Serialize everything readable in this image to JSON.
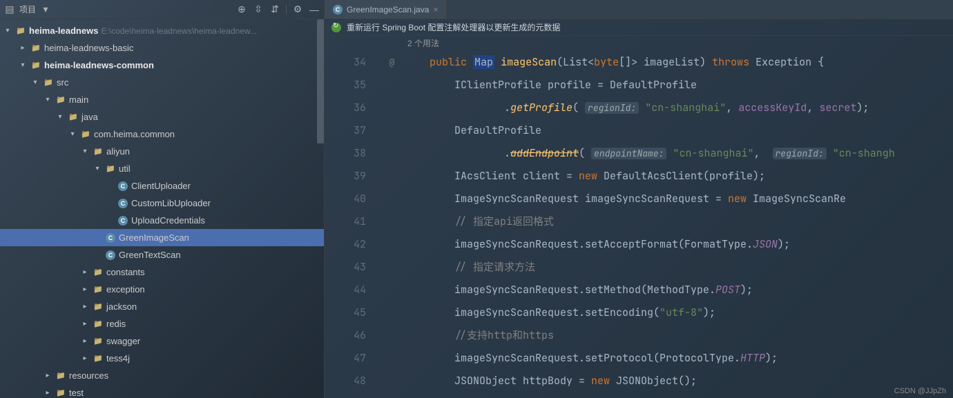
{
  "toolbar": {
    "label": "项目",
    "dropdown_icon": "chevron-down"
  },
  "tree": {
    "root": {
      "name": "heima-leadnews",
      "path": "E:\\code\\heima-leadnews\\heima-leadnew..."
    },
    "items": [
      {
        "level": 1,
        "name": "heima-leadnews-basic",
        "arrow": ">"
      },
      {
        "level": 1,
        "name": "heima-leadnews-common",
        "arrow": "v",
        "bold": true
      },
      {
        "level": 2,
        "name": "src",
        "arrow": "v"
      },
      {
        "level": 3,
        "name": "main",
        "arrow": "v"
      },
      {
        "level": 4,
        "name": "java",
        "arrow": "v"
      },
      {
        "level": 5,
        "name": "com.heima.common",
        "arrow": "v"
      },
      {
        "level": 6,
        "name": "aliyun",
        "arrow": "v"
      },
      {
        "level": 7,
        "name": "util",
        "arrow": "v"
      },
      {
        "level": 8,
        "name": "ClientUploader",
        "class": true
      },
      {
        "level": 8,
        "name": "CustomLibUploader",
        "class": true
      },
      {
        "level": 8,
        "name": "UploadCredentials",
        "class": true
      },
      {
        "level": 7,
        "name": "GreenImageScan",
        "class": true,
        "selected": true
      },
      {
        "level": 7,
        "name": "GreenTextScan",
        "class": true
      },
      {
        "level": 6,
        "name": "constants",
        "arrow": ">"
      },
      {
        "level": 6,
        "name": "exception",
        "arrow": ">"
      },
      {
        "level": 6,
        "name": "jackson",
        "arrow": ">"
      },
      {
        "level": 6,
        "name": "redis",
        "arrow": ">"
      },
      {
        "level": 6,
        "name": "swagger",
        "arrow": ">"
      },
      {
        "level": 6,
        "name": "tess4j",
        "arrow": ">"
      },
      {
        "level": 3,
        "name": "resources",
        "arrow": ">"
      },
      {
        "level": 3,
        "name": "test",
        "arrow": ">"
      }
    ]
  },
  "tab": {
    "title": "GreenImageScan.java"
  },
  "notification": {
    "text": "重新运行 Spring Boot 配置注解处理器以更新生成的元数据"
  },
  "editor": {
    "usages": "2 个用法",
    "lines": [
      34,
      35,
      36,
      37,
      38,
      39,
      40,
      41,
      42,
      43,
      44,
      45,
      46,
      47,
      48
    ]
  },
  "code": {
    "l34_public": "public",
    "l34_map": "Map",
    "l34_method": "imageScan",
    "l34_list": "List",
    "l34_byte": "byte",
    "l34_param": "imageList",
    "l34_throws": "throws",
    "l34_exc": "Exception",
    "l35": "IClientProfile profile = DefaultProfile",
    "l36_method": "getProfile",
    "l36_hint": "regionId:",
    "l36_str": "\"cn-shanghai\"",
    "l36_f1": "accessKeyId",
    "l36_f2": "secret",
    "l37": "DefaultProfile",
    "l38_method": "addEndpoint",
    "l38_hint1": "endpointName:",
    "l38_str1": "\"cn-shanghai\"",
    "l38_hint2": "regionId:",
    "l38_str2": "\"cn-shangh",
    "l39_a": "IAcsClient client = ",
    "l39_new": "new",
    "l39_b": " DefaultAcsClient(profile);",
    "l40_a": "ImageSyncScanRequest imageSyncScanRequest = ",
    "l40_new": "new",
    "l40_b": " ImageSyncScanRe",
    "l41": "// 指定api返回格式",
    "l42_a": "imageSyncScanRequest.setAcceptFormat(FormatType.",
    "l42_c": "JSON",
    "l42_b": ");",
    "l43": "// 指定请求方法",
    "l44_a": "imageSyncScanRequest.setMethod(MethodType.",
    "l44_c": "POST",
    "l44_b": ");",
    "l45_a": "imageSyncScanRequest.setEncoding(",
    "l45_s": "\"utf-8\"",
    "l45_b": ");",
    "l46": "//支持http和https",
    "l47_a": "imageSyncScanRequest.setProtocol(ProtocolType.",
    "l47_c": "HTTP",
    "l47_b": ");",
    "l48_a": "JSONObject httpBody = ",
    "l48_new": "new",
    "l48_b": " JSONObject();"
  },
  "watermark": "CSDN @JJpZh"
}
